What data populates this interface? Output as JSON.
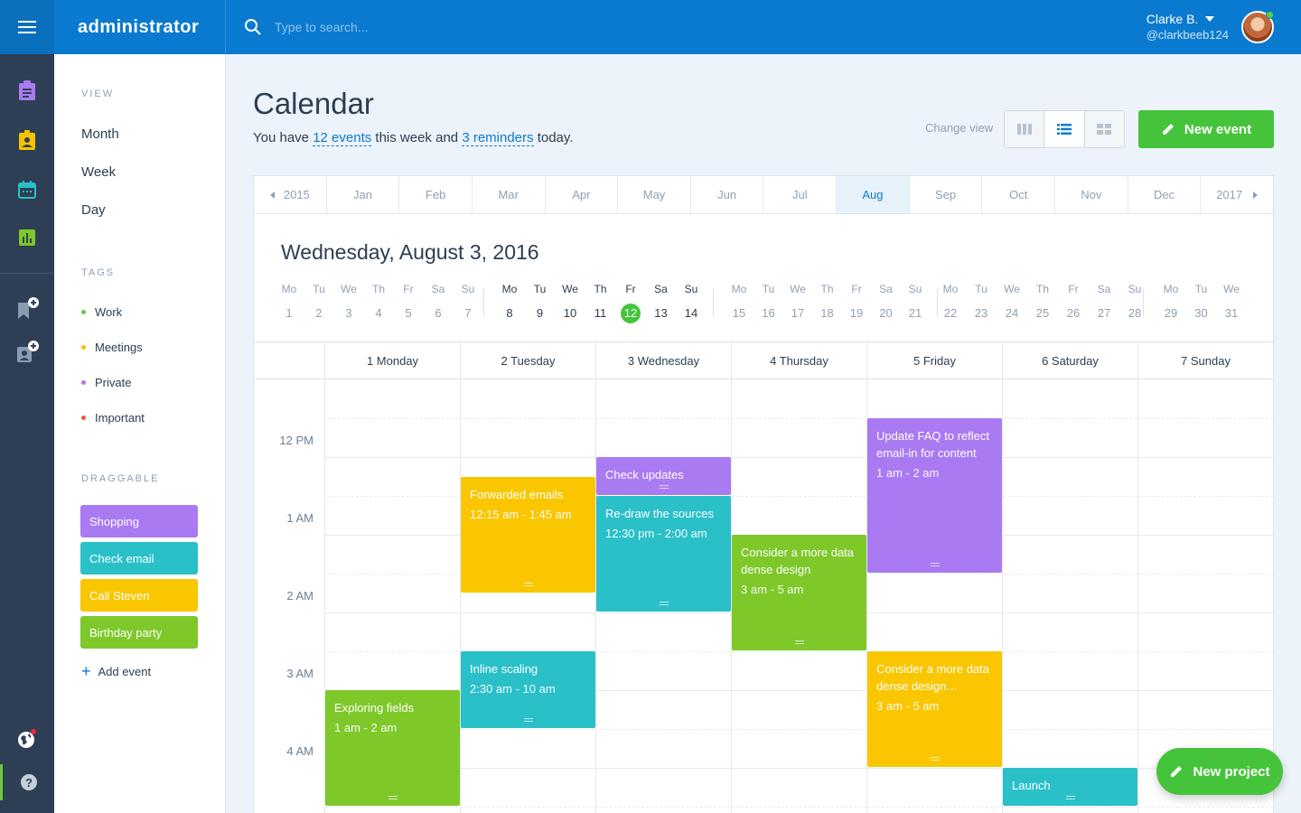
{
  "topbar": {
    "brand": "administrator",
    "search_placeholder": "Type to search...",
    "user_name": "Clarke B.",
    "user_handle": "@clarkbeeb124"
  },
  "sidebar_icons": [
    "clipboard-icon",
    "contact-card-icon",
    "calendar-icon",
    "chart-icon",
    "bookmark-add-icon",
    "contact-add-icon",
    "globe-icon",
    "help-icon"
  ],
  "nav": {
    "view_heading": "VIEW",
    "views": [
      "Month",
      "Week",
      "Day"
    ],
    "tags_heading": "TAGS",
    "tags": [
      {
        "label": "Work",
        "color": "#69c93c"
      },
      {
        "label": "Meetings",
        "color": "#f5c300"
      },
      {
        "label": "Private",
        "color": "#a97af2"
      },
      {
        "label": "Important",
        "color": "#f0543c"
      }
    ],
    "draggable_heading": "DRAGGABLE",
    "draggables": [
      {
        "label": "Shopping",
        "color": "#a97af2"
      },
      {
        "label": "Check email",
        "color": "#2ac0c8"
      },
      {
        "label": "Call Steven",
        "color": "#f9c600"
      },
      {
        "label": "Birthday party",
        "color": "#7ec82a"
      }
    ],
    "add_event": "Add event"
  },
  "main": {
    "title": "Calendar",
    "subtitle_prefix": "You have",
    "events_link": "12 events",
    "subtitle_mid": "this week and",
    "reminders_link": "3 reminders",
    "subtitle_suffix": "today.",
    "change_view_label": "Change view",
    "new_event_label": "New event"
  },
  "months": {
    "prev_year": "2015",
    "next_year": "2017",
    "items": [
      "Jan",
      "Feb",
      "Mar",
      "Apr",
      "May",
      "Jun",
      "Jul",
      "Aug",
      "Sep",
      "Oct",
      "Nov",
      "Dec"
    ],
    "active": "Aug"
  },
  "date_heading": "Wednesday, August 3,  2016",
  "week_strip": [
    {
      "days": [
        [
          "Mo",
          "1"
        ],
        [
          "Tu",
          "2"
        ],
        [
          "We",
          "3"
        ],
        [
          "Th",
          "4"
        ],
        [
          "Fr",
          "5"
        ],
        [
          "Sa",
          "6"
        ],
        [
          "Su",
          "7"
        ]
      ]
    },
    {
      "days": [
        [
          "Mo",
          "8"
        ],
        [
          "Tu",
          "9"
        ],
        [
          "We",
          "10"
        ],
        [
          "Th",
          "11"
        ],
        [
          "Fr",
          "12"
        ],
        [
          "Sa",
          "13"
        ],
        [
          "Su",
          "14"
        ]
      ],
      "current": true,
      "today": "12"
    },
    {
      "days": [
        [
          "Mo",
          "15"
        ],
        [
          "Tu",
          "16"
        ],
        [
          "We",
          "17"
        ],
        [
          "Th",
          "18"
        ],
        [
          "Fr",
          "19"
        ],
        [
          "Sa",
          "20"
        ],
        [
          "Su",
          "21"
        ]
      ]
    },
    {
      "days": [
        [
          "Mo",
          "22"
        ],
        [
          "Tu",
          "23"
        ],
        [
          "We",
          "24"
        ],
        [
          "Th",
          "25"
        ],
        [
          "Fr",
          "26"
        ],
        [
          "Sa",
          "27"
        ],
        [
          "Su",
          "28"
        ]
      ]
    },
    {
      "days": [
        [
          "Mo",
          "29"
        ],
        [
          "Tu",
          "30"
        ],
        [
          "We",
          "31"
        ]
      ]
    }
  ],
  "day_headers": [
    "1 Monday",
    "2 Tuesday",
    "3 Wednesday",
    "4 Thursday",
    "5 Friday",
    "6 Saturday",
    "7 Sunday"
  ],
  "hour_labels": [
    "12 PM",
    "1 AM",
    "2 AM",
    "3 AM",
    "4 AM"
  ],
  "events": [
    {
      "title": "Exploring fields",
      "time": "1 am - 2 am",
      "color": "#7ec82a",
      "day": 0,
      "start": 3.0,
      "end": 4.5
    },
    {
      "title": "Forwarded emails",
      "time": "12:15 am - 1:45 am",
      "color": "#f9c600",
      "day": 1,
      "start": 0.25,
      "end": 1.75
    },
    {
      "title": "Inline scaling",
      "time": "2:30 am - 10 am",
      "color": "#2ac0c8",
      "day": 1,
      "start": 2.5,
      "end": 3.5
    },
    {
      "title": "Check updates",
      "time": "",
      "color": "#a97af2",
      "day": 2,
      "start": 0.0,
      "end": 0.5
    },
    {
      "title": "Re-draw the sources",
      "time": "12:30 pm - 2:00 am",
      "color": "#2ac0c8",
      "day": 2,
      "start": 0.5,
      "end": 2.0
    },
    {
      "title": "Consider a more data dense design",
      "time": "3 am - 5 am",
      "color": "#7ec82a",
      "day": 3,
      "start": 1.0,
      "end": 2.5
    },
    {
      "title": "Update FAQ to reflect email-in for content",
      "time": "1 am - 2 am",
      "color": "#a97af2",
      "day": 4,
      "start": -0.5,
      "end": 1.5
    },
    {
      "title": "Consider a more data dense design…",
      "time": "3 am - 5 am",
      "color": "#f9c600",
      "day": 4,
      "start": 2.5,
      "end": 4.0
    },
    {
      "title": "Launch",
      "time": "",
      "color": "#2ac0c8",
      "day": 5,
      "start": 4.0,
      "end": 4.5
    }
  ],
  "fab_label": "New project"
}
